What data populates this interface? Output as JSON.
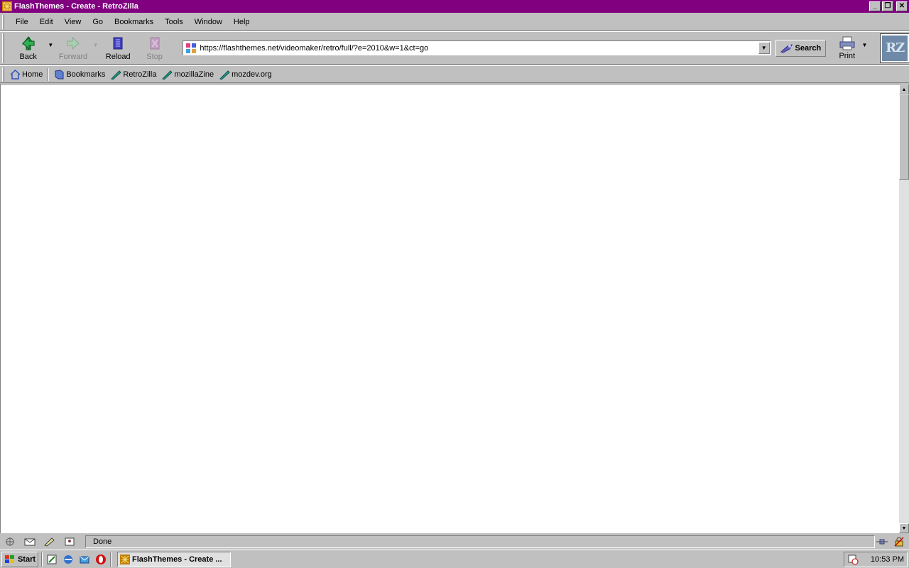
{
  "window": {
    "title": "FlashThemes - Create - RetroZilla",
    "title_bar_color": "#800080",
    "buttons": {
      "minimize": "_",
      "maximize": "❐",
      "close": "✕"
    }
  },
  "menu": [
    "File",
    "Edit",
    "View",
    "Go",
    "Bookmarks",
    "Tools",
    "Window",
    "Help"
  ],
  "nav": {
    "back": "Back",
    "forward": "Forward",
    "reload": "Reload",
    "stop": "Stop",
    "url": "https://flashthemes.net/videomaker/retro/full/?e=2010&w=1&ct=go",
    "search": "Search",
    "print": "Print",
    "logo_text": "RZ"
  },
  "personal_toolbar": {
    "home": "Home",
    "bookmarks": "Bookmarks",
    "links": [
      "RetroZilla",
      "mozillaZine",
      "mozdev.org"
    ]
  },
  "status": {
    "text": "Done"
  },
  "taskbar": {
    "start": "Start",
    "task_label": "FlashThemes - Create ...",
    "clock": "10:53 PM"
  }
}
